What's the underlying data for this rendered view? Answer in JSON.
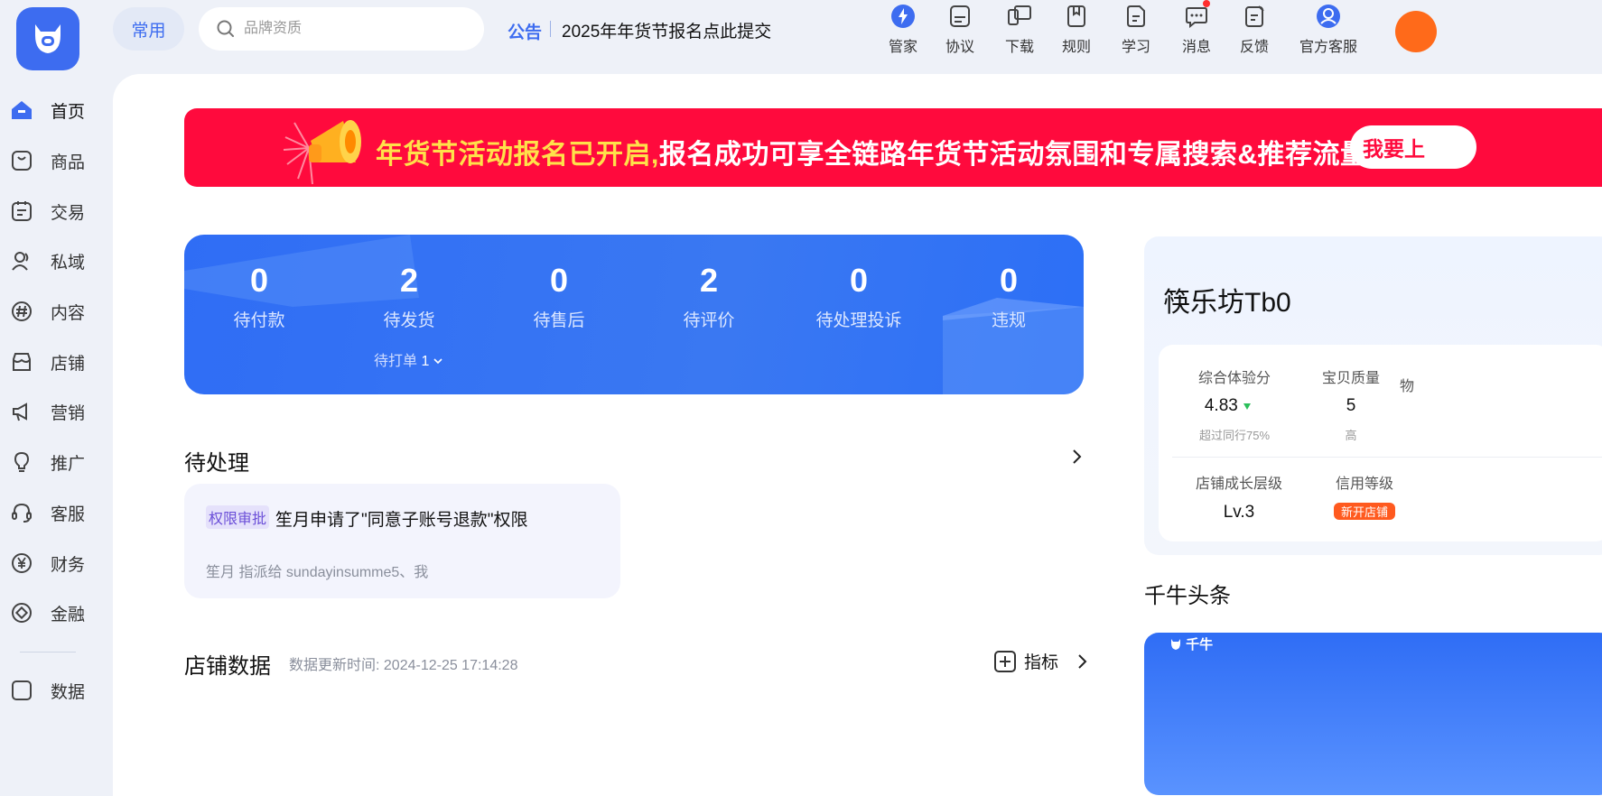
{
  "header": {
    "common_label": "常用",
    "search_placeholder": "品牌资质",
    "notice_tag": "公告",
    "notice_text": "2025年年货节报名点此提交",
    "tools": [
      {
        "label": "管家",
        "icon": "lightning-icon"
      },
      {
        "label": "协议",
        "icon": "agreement-icon"
      },
      {
        "label": "下载",
        "icon": "devices-icon"
      },
      {
        "label": "规则",
        "icon": "book-icon"
      },
      {
        "label": "学习",
        "icon": "learn-icon"
      },
      {
        "label": "消息",
        "icon": "message-icon"
      },
      {
        "label": "反馈",
        "icon": "feedback-icon"
      },
      {
        "label": "官方客服",
        "icon": "support-icon"
      }
    ]
  },
  "sidebar": {
    "items": [
      {
        "label": "首页",
        "icon": "home-icon",
        "active": true
      },
      {
        "label": "商品",
        "icon": "goods-icon"
      },
      {
        "label": "交易",
        "icon": "trade-icon"
      },
      {
        "label": "私域",
        "icon": "private-domain-icon"
      },
      {
        "label": "内容",
        "icon": "content-icon"
      },
      {
        "label": "店铺",
        "icon": "store-icon"
      },
      {
        "label": "营销",
        "icon": "marketing-icon"
      },
      {
        "label": "推广",
        "icon": "promotion-icon"
      },
      {
        "label": "客服",
        "icon": "headset-icon"
      },
      {
        "label": "财务",
        "icon": "yuan-icon"
      },
      {
        "label": "金融",
        "icon": "finance-icon"
      },
      {
        "label": "数据",
        "icon": "data-icon"
      }
    ]
  },
  "banner": {
    "highlight": "年货节活动报名已开启,",
    "text": "报名成功可享全链路年货节活动氛围和专属搜索&推荐流量!",
    "button": "我要上"
  },
  "stats": [
    {
      "value": "0",
      "label": "待付款"
    },
    {
      "value": "2",
      "label": "待发货"
    },
    {
      "value": "0",
      "label": "待售后"
    },
    {
      "value": "2",
      "label": "待评价"
    },
    {
      "value": "0",
      "label": "待处理投诉"
    },
    {
      "value": "0",
      "label": "违规"
    }
  ],
  "print_pending": {
    "label": "待打单",
    "count": "1"
  },
  "todo": {
    "title": "待处理",
    "tag": "权限审批",
    "item_title": "笙月申请了\"同意子账号退款\"权限",
    "meta": "笙月 指派给 sundayinsumme5、我"
  },
  "store_data": {
    "title": "店铺数据",
    "update_time": "数据更新时间:  2024-12-25 17:14:28",
    "metric_button": "指标"
  },
  "shop": {
    "name": "筷乐坊Tb0",
    "scores": [
      {
        "label": "综合体验分",
        "value": "4.83",
        "trend": "down",
        "sub": "超过同行75%"
      },
      {
        "label": "宝贝质量",
        "value": "5",
        "sub": "高"
      },
      {
        "label": "物",
        "value": "",
        "sub": ""
      }
    ],
    "growth_label": "店铺成长层级",
    "growth_value": "Lv.3",
    "credit_label": "信用等级",
    "credit_badge": "新开店铺"
  },
  "headlines": {
    "title": "千牛头条",
    "logo_text": "千牛"
  },
  "colors": {
    "brand_blue": "#3d6cf0",
    "banner_red": "#ff0a3d",
    "banner_yellow": "#ffe14a",
    "badge_orange": "#ff5a1f",
    "trend_green": "#2bbf5a"
  }
}
